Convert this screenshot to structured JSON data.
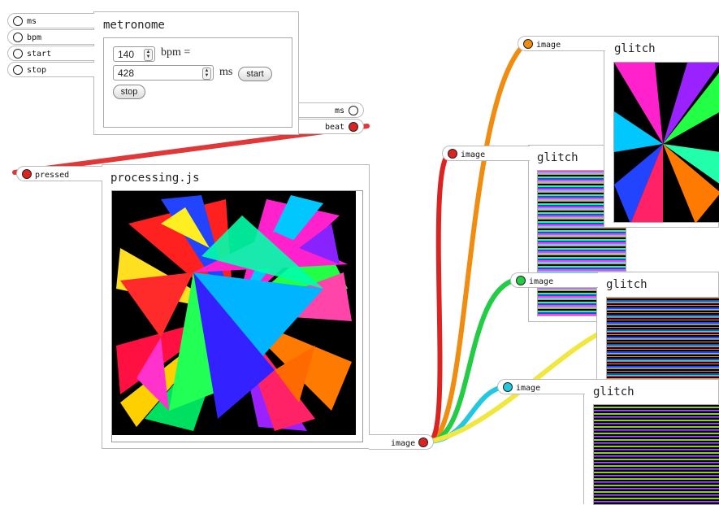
{
  "colors": {
    "wire_red": "#dd2222",
    "wire_orange": "#f08c10",
    "wire_green": "#22cc44",
    "wire_cyan": "#22c8e0",
    "wire_yellow": "#f0e840",
    "port_red": "#dd2222",
    "port_orange": "#f08c10",
    "port_green": "#22cc44",
    "port_cyan": "#22c8e0",
    "port_empty": "#ffffff"
  },
  "metronome": {
    "title": "metronome",
    "inputs": [
      "ms",
      "bpm",
      "start",
      "stop"
    ],
    "bpm_value": "140",
    "bpm_label": "bpm =",
    "ms_value": "428",
    "ms_label": "ms",
    "start_button": "start",
    "stop_button": "stop",
    "outputs": [
      "ms",
      "beat"
    ]
  },
  "processing": {
    "title": "processing.js",
    "input": "pressed",
    "output": "image"
  },
  "glitch_nodes": [
    {
      "title": "glitch",
      "input": "image",
      "port_color": "orange"
    },
    {
      "title": "glitch",
      "input": "image",
      "port_color": "red"
    },
    {
      "title": "glitch",
      "input": "image",
      "port_color": "green"
    },
    {
      "title": "glitch",
      "input": "image",
      "port_color": "cyan"
    }
  ]
}
